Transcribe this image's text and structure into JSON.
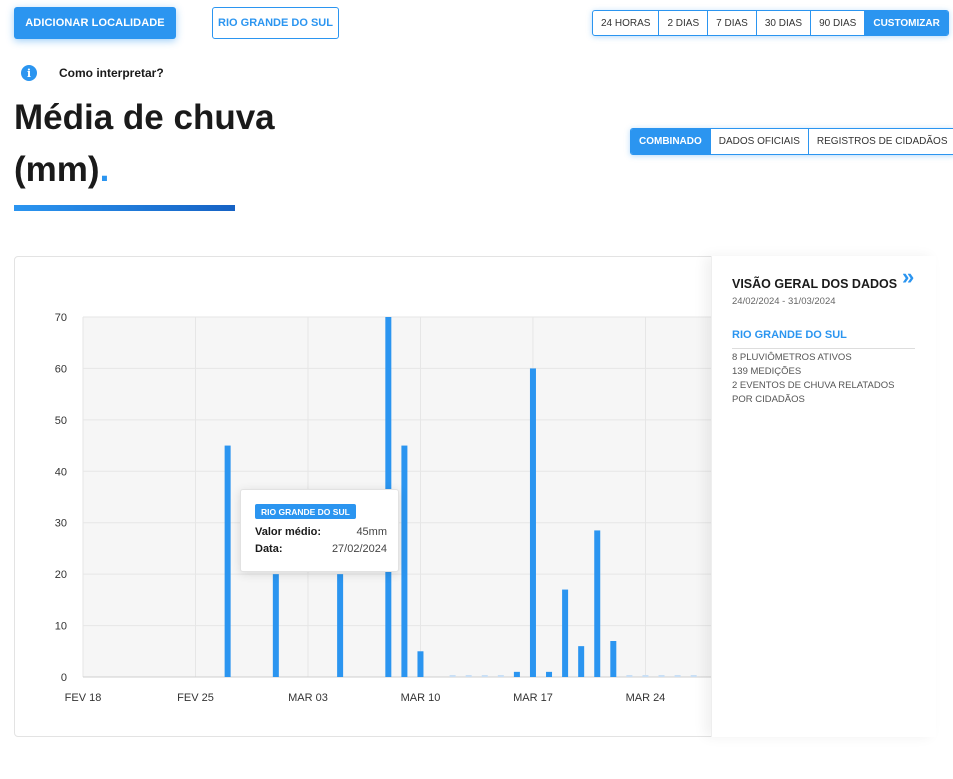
{
  "toolbar": {
    "add_location": "ADICIONAR LOCALIDADE",
    "region_button": "RIO GRANDE DO SUL",
    "ranges": [
      "24 HORAS",
      "2 DIAS",
      "7 DIAS",
      "30 DIAS",
      "90 DIAS",
      "CUSTOMIZAR"
    ],
    "active_range": "CUSTOMIZAR"
  },
  "info": {
    "label": "Como interpretar?"
  },
  "heading": {
    "line1": "Média de chuva",
    "line2": "(mm)",
    "dot": "."
  },
  "sources": {
    "options": [
      "COMBINADO",
      "DADOS OFICIAIS",
      "REGISTROS DE CIDADÃOS"
    ],
    "active": "COMBINADO"
  },
  "panel": {
    "title": "VISÃO GERAL DOS DADOS",
    "date_range": "24/02/2024 - 31/03/2024",
    "region": "RIO GRANDE DO SUL",
    "stats": [
      "8 PLUVIÔMETROS ATIVOS",
      "139 MEDIÇÕES",
      "2 EVENTOS DE CHUVA RELATADOS POR CIDADÃOS"
    ]
  },
  "tooltip": {
    "badge": "RIO GRANDE DO SUL",
    "value_label": "Valor médio:",
    "value": "45mm",
    "date_label": "Data:",
    "date": "27/02/2024"
  },
  "colors": {
    "accent": "#2b95f0",
    "bar": "#2b95f0",
    "zero_bar": "#c9dff5",
    "grid": "#e6e6e6"
  },
  "chart_data": {
    "type": "bar",
    "title": "Média de chuva (mm)",
    "ylabel": "",
    "xlabel": "",
    "ylim": [
      0,
      70
    ],
    "yticks": [
      0,
      10,
      20,
      30,
      40,
      50,
      60,
      70
    ],
    "x_ticks": [
      {
        "day": 0,
        "label": "FEV 18"
      },
      {
        "day": 7,
        "label": "FEV 25"
      },
      {
        "day": 14,
        "label": "MAR 03"
      },
      {
        "day": 21,
        "label": "MAR 10"
      },
      {
        "day": 28,
        "label": "MAR 17"
      },
      {
        "day": 35,
        "label": "MAR 24"
      }
    ],
    "x_start_date": "2024-02-18",
    "grid": true,
    "bars": [
      {
        "date": "2024-02-27",
        "value": 45
      },
      {
        "date": "2024-03-01",
        "value": 20
      },
      {
        "date": "2024-03-05",
        "value": 20
      },
      {
        "date": "2024-03-08",
        "value": 70
      },
      {
        "date": "2024-03-09",
        "value": 45
      },
      {
        "date": "2024-03-10",
        "value": 5
      },
      {
        "date": "2024-03-12",
        "value": 0.5
      },
      {
        "date": "2024-03-13",
        "value": 0.5
      },
      {
        "date": "2024-03-14",
        "value": 0.5
      },
      {
        "date": "2024-03-15",
        "value": 0.5
      },
      {
        "date": "2024-03-16",
        "value": 1
      },
      {
        "date": "2024-03-17",
        "value": 60
      },
      {
        "date": "2024-03-18",
        "value": 1
      },
      {
        "date": "2024-03-19",
        "value": 17
      },
      {
        "date": "2024-03-20",
        "value": 6
      },
      {
        "date": "2024-03-21",
        "value": 28.5
      },
      {
        "date": "2024-03-22",
        "value": 7
      },
      {
        "date": "2024-03-23",
        "value": 0.5
      },
      {
        "date": "2024-03-24",
        "value": 0.5
      },
      {
        "date": "2024-03-25",
        "value": 0.5
      },
      {
        "date": "2024-03-26",
        "value": 0.5
      },
      {
        "date": "2024-03-27",
        "value": 0.5
      }
    ]
  }
}
